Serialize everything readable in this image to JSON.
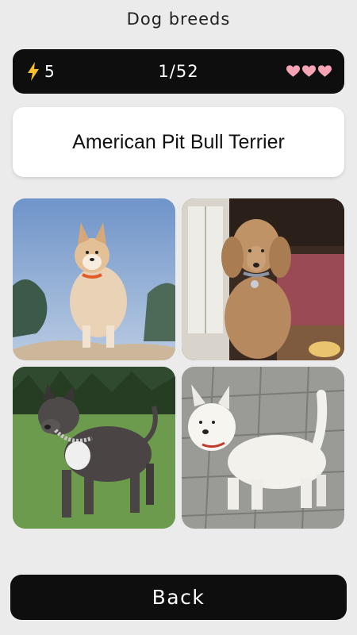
{
  "header": {
    "title": "Dog breeds"
  },
  "status": {
    "energy_icon": "lightning-bolt-icon",
    "energy_count": "5",
    "progress": "1/52",
    "lives": 3,
    "heart_color": "#f5a3b5"
  },
  "question": {
    "breed_name": "American Pit Bull Terrier"
  },
  "options": [
    {
      "icon": "akita-dog-photo"
    },
    {
      "icon": "poodle-dog-photo"
    },
    {
      "icon": "pit-bull-dog-photo"
    },
    {
      "icon": "west-highland-terrier-dog-photo"
    }
  ],
  "footer": {
    "back_label": "Back"
  },
  "colors": {
    "background": "#ebebeb",
    "bar": "#0e0e0e",
    "card": "#ffffff"
  }
}
